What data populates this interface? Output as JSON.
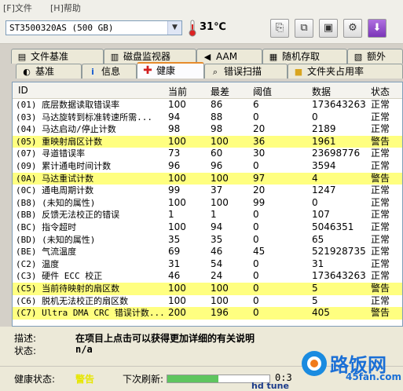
{
  "menu": {
    "file": "[F]文件",
    "help": "[H]帮助"
  },
  "toolbar": {
    "drive": "ST3500320AS (500 GB)",
    "temperature": "31℃",
    "buttons": [
      "copy-icon",
      "copy-all-icon",
      "save-icon",
      "options-icon",
      "exit-icon"
    ]
  },
  "tabs_top": [
    "文件基准",
    "磁盘监视器",
    "AAM",
    "随机存取",
    "额外"
  ],
  "tabs_bottom": [
    "基准",
    "信息",
    "健康",
    "错误扫描",
    "文件夹占用率"
  ],
  "active_tab": "健康",
  "table": {
    "columns": [
      "ID",
      "当前",
      "最差",
      "阈值",
      "数据",
      "状态"
    ],
    "rows": [
      {
        "id": "(01) 底层数据读取错误率",
        "current": "100",
        "worst": "86",
        "threshold": "6",
        "data": "173643263",
        "status": "正常",
        "warn": false
      },
      {
        "id": "(03) 马达旋转到标准转速所需...",
        "current": "94",
        "worst": "88",
        "threshold": "0",
        "data": "0",
        "status": "正常",
        "warn": false
      },
      {
        "id": "(04) 马达启动/停止计数",
        "current": "98",
        "worst": "98",
        "threshold": "20",
        "data": "2189",
        "status": "正常",
        "warn": false
      },
      {
        "id": "(05) 重映射扇区计数",
        "current": "100",
        "worst": "100",
        "threshold": "36",
        "data": "1961",
        "status": "警告",
        "warn": true
      },
      {
        "id": "(07) 寻道错误率",
        "current": "73",
        "worst": "60",
        "threshold": "30",
        "data": "23698776",
        "status": "正常",
        "warn": false
      },
      {
        "id": "(09) 累计通电时间计数",
        "current": "96",
        "worst": "96",
        "threshold": "0",
        "data": "3594",
        "status": "正常",
        "warn": false
      },
      {
        "id": "(0A) 马达重试计数",
        "current": "100",
        "worst": "100",
        "threshold": "97",
        "data": "4",
        "status": "警告",
        "warn": true
      },
      {
        "id": "(0C) 通电周期计数",
        "current": "99",
        "worst": "37",
        "threshold": "20",
        "data": "1247",
        "status": "正常",
        "warn": false
      },
      {
        "id": "(B8) (未知的属性)",
        "current": "100",
        "worst": "100",
        "threshold": "99",
        "data": "0",
        "status": "正常",
        "warn": false
      },
      {
        "id": "(BB) 反馈无法校正的错误",
        "current": "1",
        "worst": "1",
        "threshold": "0",
        "data": "107",
        "status": "正常",
        "warn": false
      },
      {
        "id": "(BC) 指令超时",
        "current": "100",
        "worst": "94",
        "threshold": "0",
        "data": "5046351",
        "status": "正常",
        "warn": false
      },
      {
        "id": "(BD) (未知的属性)",
        "current": "35",
        "worst": "35",
        "threshold": "0",
        "data": "65",
        "status": "正常",
        "warn": false
      },
      {
        "id": "(BE) 气流温度",
        "current": "69",
        "worst": "46",
        "threshold": "45",
        "data": "521928735",
        "status": "正常",
        "warn": false
      },
      {
        "id": "(C2) 温度",
        "current": "31",
        "worst": "54",
        "threshold": "0",
        "data": "31",
        "status": "正常",
        "warn": false
      },
      {
        "id": "(C3) 硬件 ECC 校正",
        "current": "46",
        "worst": "24",
        "threshold": "0",
        "data": "173643263",
        "status": "正常",
        "warn": false
      },
      {
        "id": "(C5) 当前待映射的扇区数",
        "current": "100",
        "worst": "100",
        "threshold": "0",
        "data": "5",
        "status": "警告",
        "warn": true
      },
      {
        "id": "(C6) 脱机无法校正的扇区数",
        "current": "100",
        "worst": "100",
        "threshold": "0",
        "data": "5",
        "status": "正常",
        "warn": false
      },
      {
        "id": "(C7) Ultra DMA CRC 错误计数...",
        "current": "200",
        "worst": "196",
        "threshold": "0",
        "data": "405",
        "status": "警告",
        "warn": true
      }
    ]
  },
  "info": {
    "desc_label": "描述:",
    "desc_value": "在项目上点击可以获得更加详细的有关说明",
    "status_label": "状态:",
    "status_value": "n/a"
  },
  "statusbar": {
    "health_label": "健康状态:",
    "health_value": "警告",
    "refresh_label": "下次刷新:",
    "refresh_progress": 0.5,
    "time": "0:3"
  },
  "watermark": {
    "site_cn": "路饭网",
    "site_url": "45fan.com",
    "footer": "hd tune"
  },
  "colors": {
    "warn_row": "#ffff80",
    "health_warn": "#ffff00",
    "active_tab_accent": "#e68b2c"
  }
}
